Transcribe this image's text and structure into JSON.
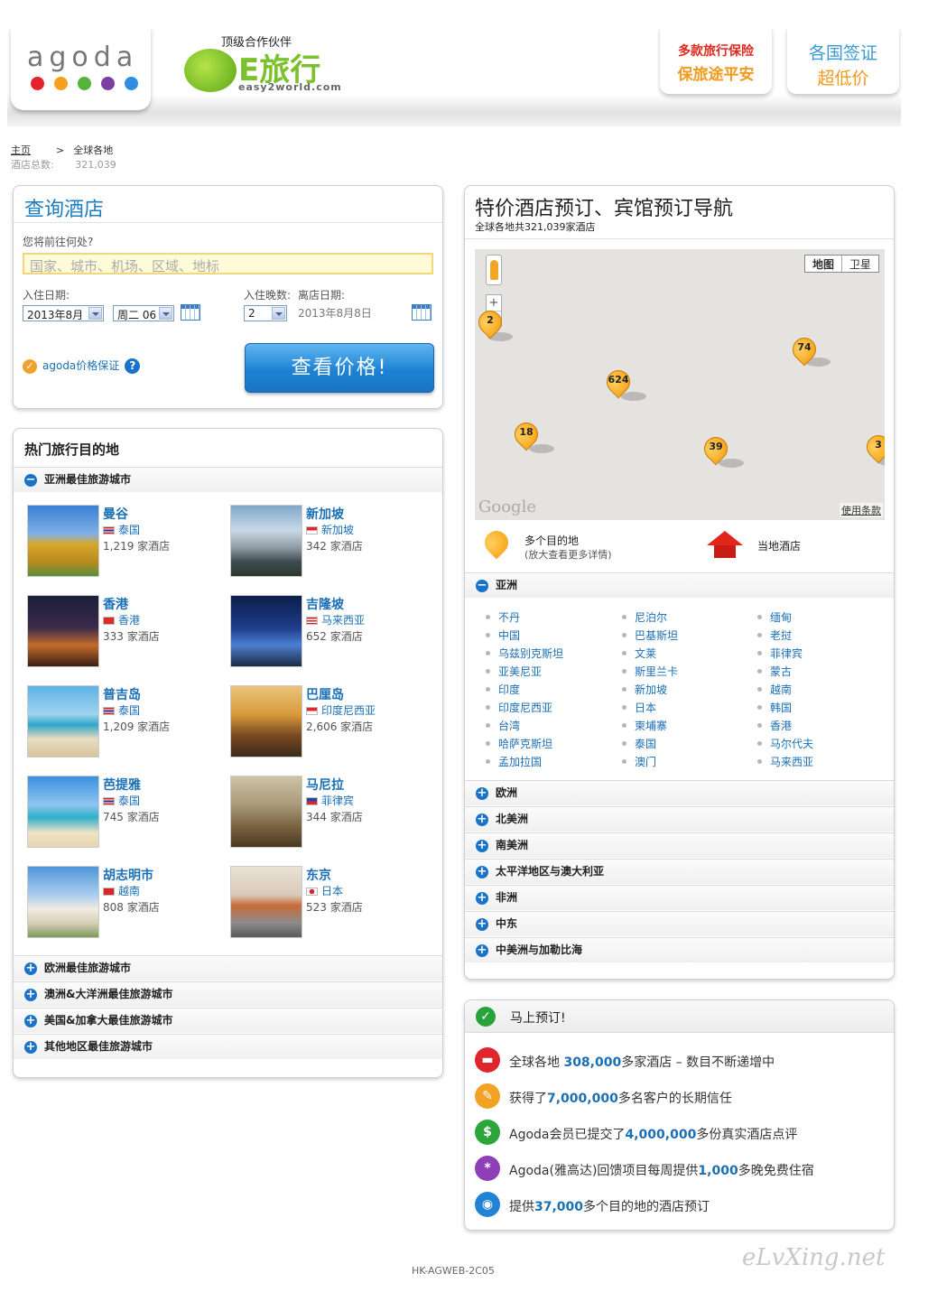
{
  "header": {
    "logo": "agoda",
    "partner_label": "顶级合作伙伴",
    "partner_name": "E旅行",
    "partner_sub": "easy2world.com",
    "ad1_line1": "多款旅行保险",
    "ad1_line2": "保旅途平安",
    "ad2_line1": "各国签证",
    "ad2_line2": "超低价",
    "dot_colors": [
      "#e5232c",
      "#f4a11d",
      "#55b33b",
      "#7e3ea0",
      "#2f8ee0"
    ]
  },
  "breadcrumb": {
    "home": "主页",
    "separator": ">",
    "current": "全球各地",
    "hotel_total_label": "酒店总数:",
    "hotel_total_value": "321,039"
  },
  "search": {
    "title": "查询酒店",
    "destination_label": "您将前往何处?",
    "destination_placeholder": "国家、城市、机场、区域、地标",
    "checkin_label": "入住日期:",
    "checkin_month": "2013年8月",
    "checkin_day": "周二 06",
    "nights_label": "入住晚数:",
    "nights_value": "2",
    "checkout_label": "离店日期:",
    "checkout_value": "2013年8月8日",
    "guarantee": "agoda价格保证",
    "button": "查看价格!"
  },
  "popular": {
    "title": "热门旅行目的地",
    "asia_section": "亚洲最佳旅游城市",
    "cities": [
      {
        "name": "曼谷",
        "country": "泰国",
        "hotels": "1,219 家酒店"
      },
      {
        "name": "新加坡",
        "country": "新加坡",
        "hotels": "342 家酒店"
      },
      {
        "name": "香港",
        "country": "香港",
        "hotels": "333 家酒店"
      },
      {
        "name": "吉隆坡",
        "country": "马来西亚",
        "hotels": "652 家酒店"
      },
      {
        "name": "普吉岛",
        "country": "泰国",
        "hotels": "1,209 家酒店"
      },
      {
        "name": "巴厘岛",
        "country": "印度尼西亚",
        "hotels": "2,606 家酒店"
      },
      {
        "name": "芭提雅",
        "country": "泰国",
        "hotels": "745 家酒店"
      },
      {
        "name": "马尼拉",
        "country": "菲律宾",
        "hotels": "344 家酒店"
      },
      {
        "name": "胡志明市",
        "country": "越南",
        "hotels": "808 家酒店"
      },
      {
        "name": "东京",
        "country": "日本",
        "hotels": "523 家酒店"
      }
    ],
    "other_sections": [
      "欧洲最佳旅游城市",
      "澳洲&大洋洲最佳旅游城市",
      "美国&加拿大最佳旅游城市",
      "其他地区最佳旅游城市"
    ]
  },
  "guide": {
    "title": "特价酒店预订、宾馆预订导航",
    "subtitle": "全球各地共321,039家酒店",
    "map_btn_map": "地图",
    "map_btn_satellite": "卫星",
    "markers": [
      "2",
      "624",
      "74",
      "18",
      "39",
      "3"
    ],
    "google": "Google",
    "terms": "使用条款",
    "legend_multi": "多个目的地",
    "legend_multi_sub": "(放大查看更多详情)",
    "legend_local": "当地酒店",
    "asia_region": "亚洲",
    "asia_col1": [
      "不丹",
      "中国",
      "乌兹别克斯坦",
      "亚美尼亚",
      "印度",
      "印度尼西亚",
      "台湾",
      "哈萨克斯坦",
      "孟加拉国"
    ],
    "asia_col2": [
      "尼泊尔",
      "巴基斯坦",
      "文莱",
      "斯里兰卡",
      "新加坡",
      "日本",
      "柬埔寨",
      "泰国",
      "澳门"
    ],
    "asia_col3": [
      "缅甸",
      "老挝",
      "菲律宾",
      "蒙古",
      "越南",
      "韩国",
      "香港",
      "马尔代夫",
      "马来西亚"
    ],
    "regions": [
      "欧洲",
      "北美洲",
      "南美洲",
      "太平洋地区与澳大利亚",
      "非洲",
      "中东",
      "中美洲与加勒比海"
    ]
  },
  "book": {
    "title": "马上预订!",
    "rows": [
      {
        "pre": "全球各地 ",
        "num": "308,000",
        "post": "多家酒店 – 数目不断递增中",
        "icon": "bed-icon",
        "color": "#e0262d"
      },
      {
        "pre": "获得了",
        "num": "7,000,000",
        "post": "多名客户的长期信任",
        "icon": "pencil-icon",
        "color": "#f2a323"
      },
      {
        "pre": "Agoda会员已提交了",
        "num": "4,000,000",
        "post": "多份真实酒店点评",
        "icon": "dollar-icon",
        "color": "#2ea43c"
      },
      {
        "pre": "Agoda(雅高达)回馈项目每周提供",
        "num": "1,000",
        "post": "多晚免费住宿",
        "icon": "star-icon",
        "color": "#8e3fb8"
      },
      {
        "pre": "提供",
        "num": "37,000",
        "post": "多个目的地的酒店预订",
        "icon": "globe-icon",
        "color": "#2183d6"
      }
    ]
  },
  "footer": {
    "code": "HK-AGWEB-2C05",
    "watermark": "eLvXing.net"
  }
}
